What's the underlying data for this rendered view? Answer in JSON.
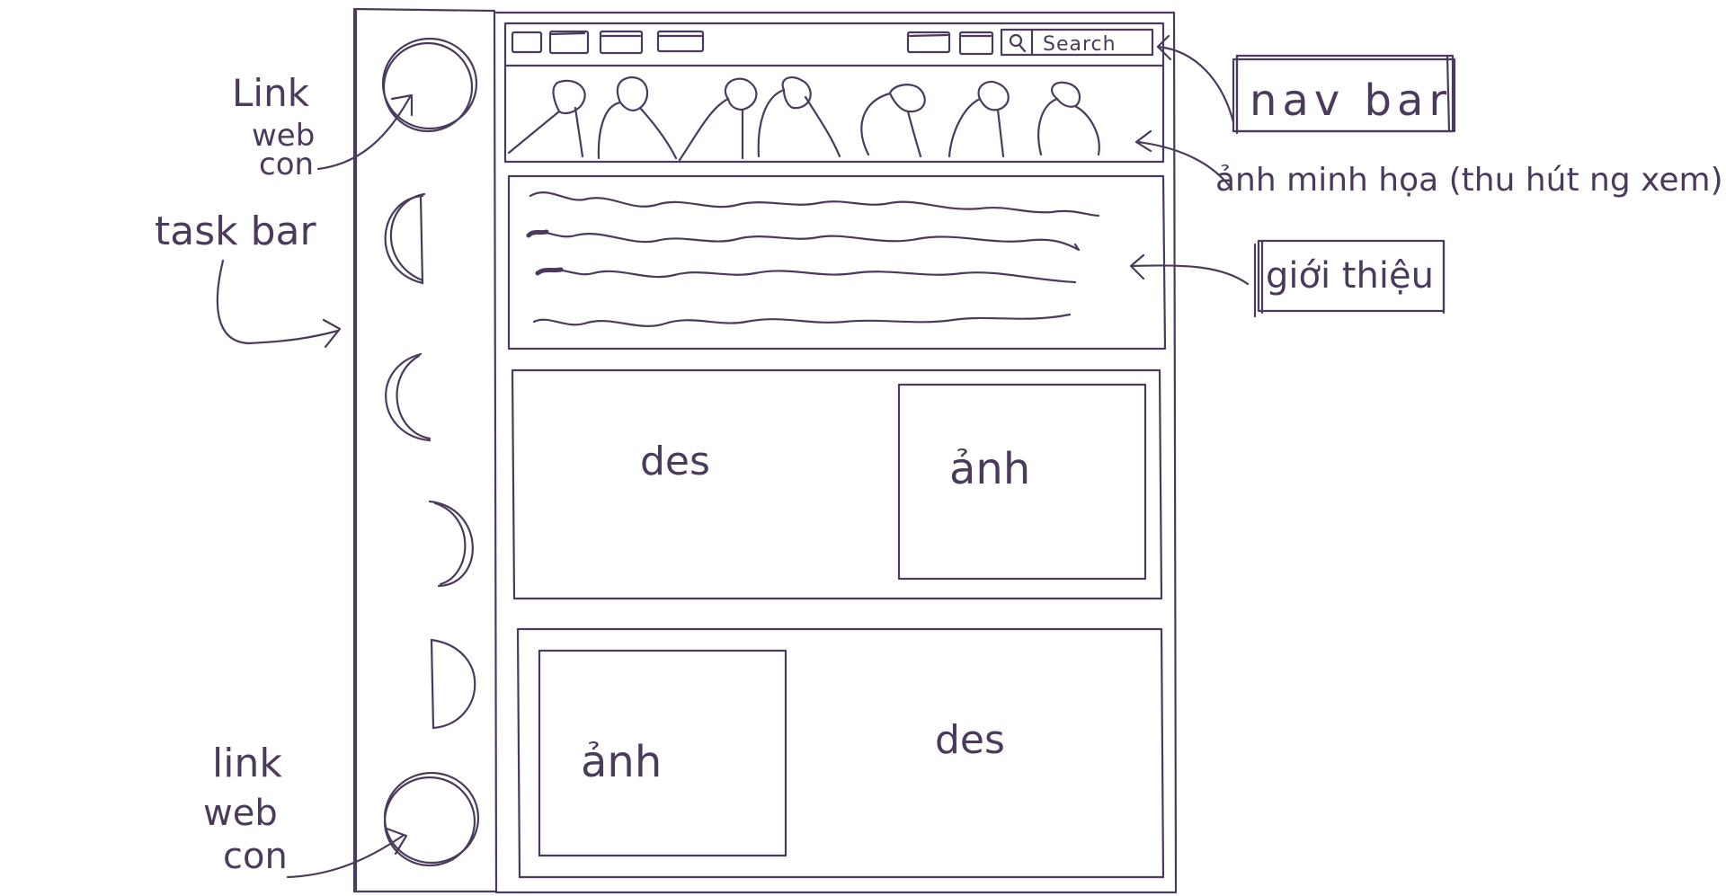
{
  "sketch": {
    "ink_color": "#4a3b5c",
    "annotations": {
      "link_top": [
        "Link",
        "web",
        "con"
      ],
      "taskbar": "task bar",
      "link_bottom": [
        "link",
        "web",
        "con"
      ],
      "navbar": "nav bar",
      "illustration": "ảnh minh họa (thu hút ng xem)",
      "intro": "giới thiệu"
    },
    "navbar": {
      "search_placeholder": "Search",
      "search_icon": "search-icon"
    },
    "section1": {
      "description": "des",
      "image_label": "ảnh"
    },
    "section2": {
      "image_label": "ảnh",
      "description": "des"
    }
  }
}
